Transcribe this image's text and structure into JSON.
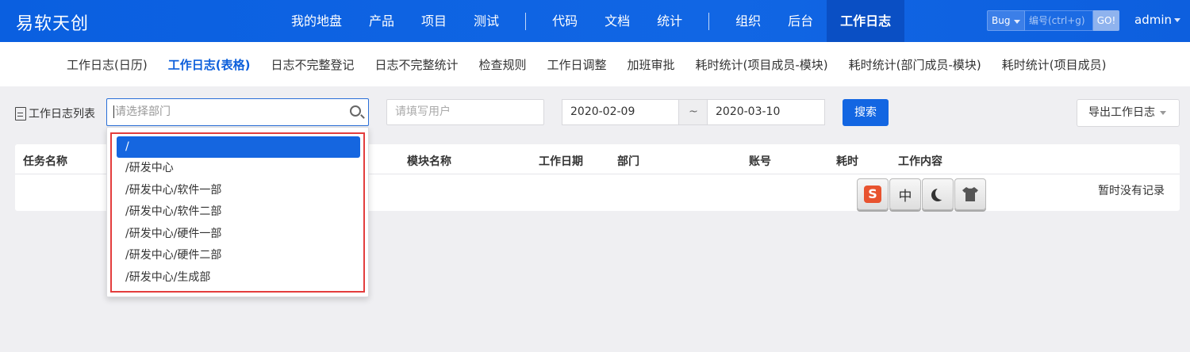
{
  "brand": "易软天创",
  "nav": {
    "group1": [
      "我的地盘",
      "产品",
      "项目",
      "测试"
    ],
    "group2": [
      "代码",
      "文档",
      "统计"
    ],
    "group3": [
      "组织",
      "后台"
    ],
    "active": "工作日志"
  },
  "quick_search": {
    "type": "Bug",
    "placeholder": "编号(ctrl+g)",
    "go": "GO!"
  },
  "user": "admin",
  "subnav": {
    "items": [
      "工作日志(日历)",
      "工作日志(表格)",
      "日志不完整登记",
      "日志不完整统计",
      "检查规则",
      "工作日调整",
      "加班审批",
      "耗时统计(项目成员-模块)",
      "耗时统计(部门成员-模块)",
      "耗时统计(项目成员)"
    ],
    "active_index": 1
  },
  "toolbar": {
    "title": "工作日志列表",
    "dept_placeholder": "请选择部门",
    "user_placeholder": "请填写用户",
    "date_from": "2020-02-09",
    "date_sep": "~",
    "date_to": "2020-03-10",
    "search": "搜索",
    "export": "导出工作日志"
  },
  "table": {
    "headers": [
      "任务名称",
      "模块名称",
      "工作日期",
      "部门",
      "账号",
      "耗时",
      "工作内容"
    ],
    "empty": "暂时没有记录"
  },
  "dept_options": [
    "/",
    "/研发中心",
    "/研发中心/软件一部",
    "/研发中心/软件二部",
    "/研发中心/硬件一部",
    "/研发中心/硬件二部",
    "/研发中心/生成部"
  ],
  "ime": {
    "logo": "S",
    "mode": "中"
  },
  "colors": {
    "primary": "#1366e2",
    "topbar": "#0a5fe0",
    "highlight_border": "#e33d3d"
  }
}
